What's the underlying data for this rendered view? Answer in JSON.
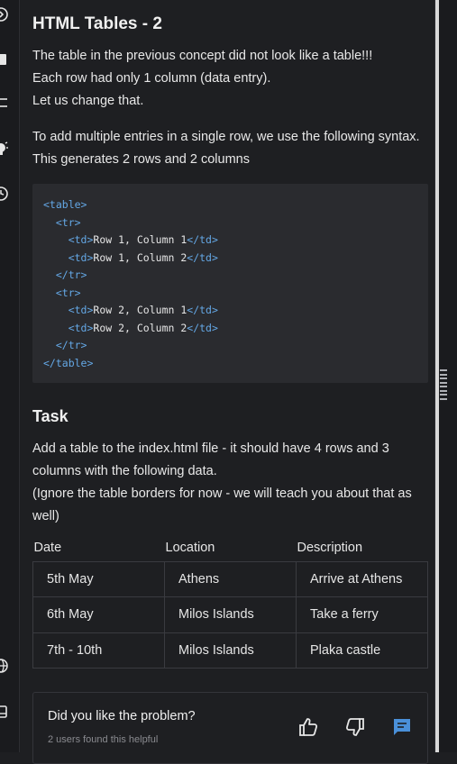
{
  "lesson": {
    "title": "HTML Tables - 2",
    "intro_lines": [
      "The table in the previous concept did not look like a table!!!",
      "Each row had only 1 column (data entry).",
      "Let us change that."
    ],
    "syntax_lines": [
      "To add multiple entries in a single row, we use the following syntax.",
      "This generates 2 rows and 2 columns"
    ],
    "code": {
      "table_open": "<table>",
      "tr_open": "<tr>",
      "td_open": "<td>",
      "r1c1": "Row 1, Column 1",
      "r1c2": "Row 1, Column 2",
      "td_close": "</td>",
      "tr_close": "</tr>",
      "r2c1": "Row 2, Column 1",
      "r2c2": "Row 2, Column 2",
      "table_close": "</table>"
    }
  },
  "task": {
    "heading": "Task",
    "lines": [
      "Add a table to the index.html file - it should have 4 rows and 3",
      "columns with the following data.",
      "(Ignore the table borders for now - we will teach you about that as",
      "well)"
    ],
    "table": {
      "headers": [
        "Date",
        "Location",
        "Description"
      ],
      "rows": [
        [
          "5th May",
          "Athens",
          "Arrive at Athens"
        ],
        [
          "6th May",
          "Milos Islands",
          "Take a ferry"
        ],
        [
          "7th - 10th",
          "Milos Islands",
          "Plaka castle"
        ]
      ]
    }
  },
  "feedback": {
    "question": "Did you like the problem?",
    "count_text": "2 users found this helpful",
    "accent_color": "#4a90d9"
  },
  "rail_icons": [
    "play-circle-icon",
    "stop-icon",
    "list-icon",
    "lightbulb-icon",
    "history-icon",
    "globe-icon",
    "terminal-icon"
  ]
}
